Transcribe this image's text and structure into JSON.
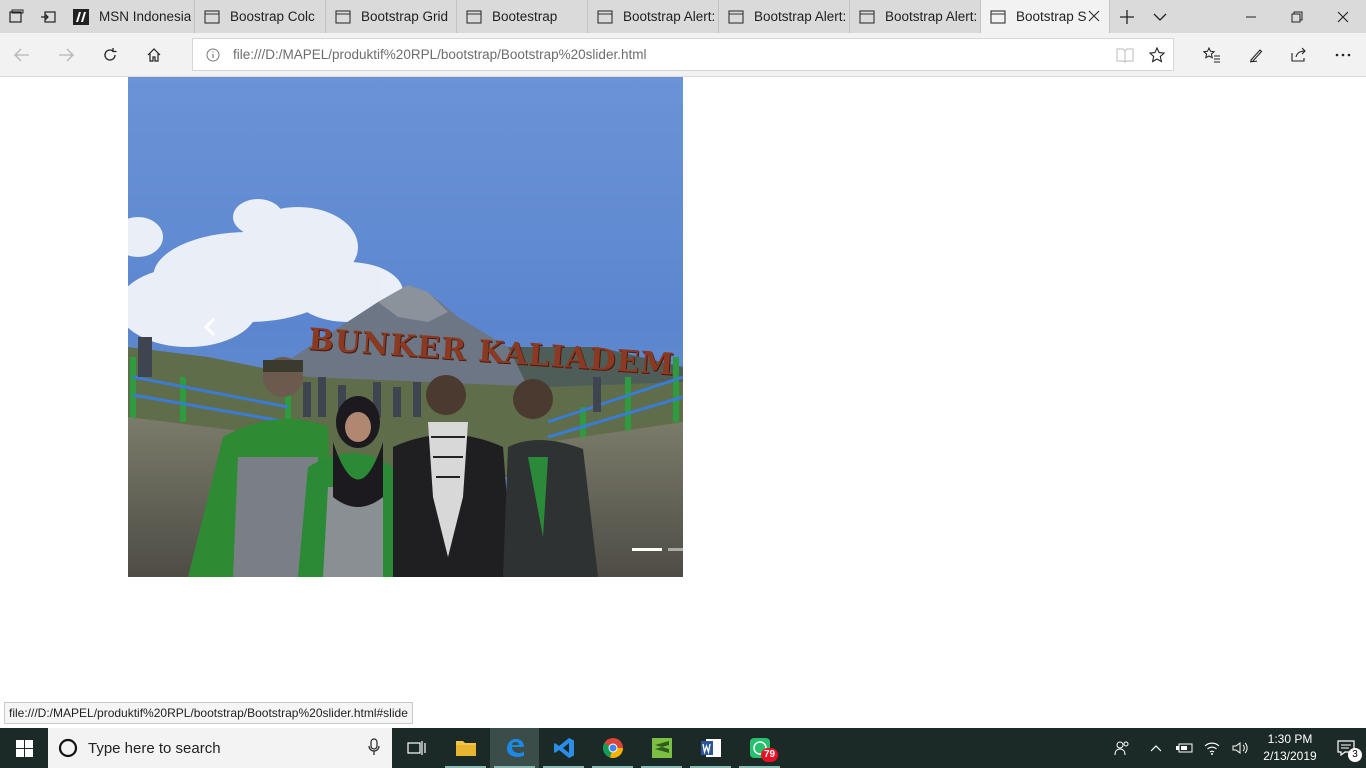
{
  "tabs": [
    {
      "label": "MSN Indonesia",
      "icon": "msn-icon",
      "active": false
    },
    {
      "label": "Boostrap Colc",
      "icon": "page-icon",
      "active": false
    },
    {
      "label": "Bootstrap Grid",
      "icon": "page-icon",
      "active": false
    },
    {
      "label": "Bootestrap",
      "icon": "page-icon",
      "active": false
    },
    {
      "label": "Bootstrap Alert:",
      "icon": "page-icon",
      "active": false
    },
    {
      "label": "Bootstrap Alert:",
      "icon": "page-icon",
      "active": false
    },
    {
      "label": "Bootstrap Alert:",
      "icon": "page-icon",
      "active": false
    },
    {
      "label": "Bootstrap S",
      "icon": "page-icon",
      "active": true
    }
  ],
  "address": {
    "url": "file:///D:/MAPEL/produktif%20RPL/bootstrap/Bootstrap%20slider.html"
  },
  "carousel": {
    "sign_text": "BUNKER KALIADEM",
    "slide_count": 2,
    "active_slide": 1
  },
  "status_url": "file:///D:/MAPEL/produktif%20RPL/bootstrap/Bootstrap%20slider.html#slide",
  "taskbar": {
    "search_placeholder": "Type here to search",
    "whatsapp_badge": "79",
    "time": "1:30 PM",
    "date": "2/13/2019",
    "notifications": "3"
  },
  "colors": {
    "tabbar_bg": "#dadada",
    "active_tab_bg": "#f2f2f2",
    "taskbar_bg": "#1b2a26",
    "edge_blue": "#0078d7"
  }
}
